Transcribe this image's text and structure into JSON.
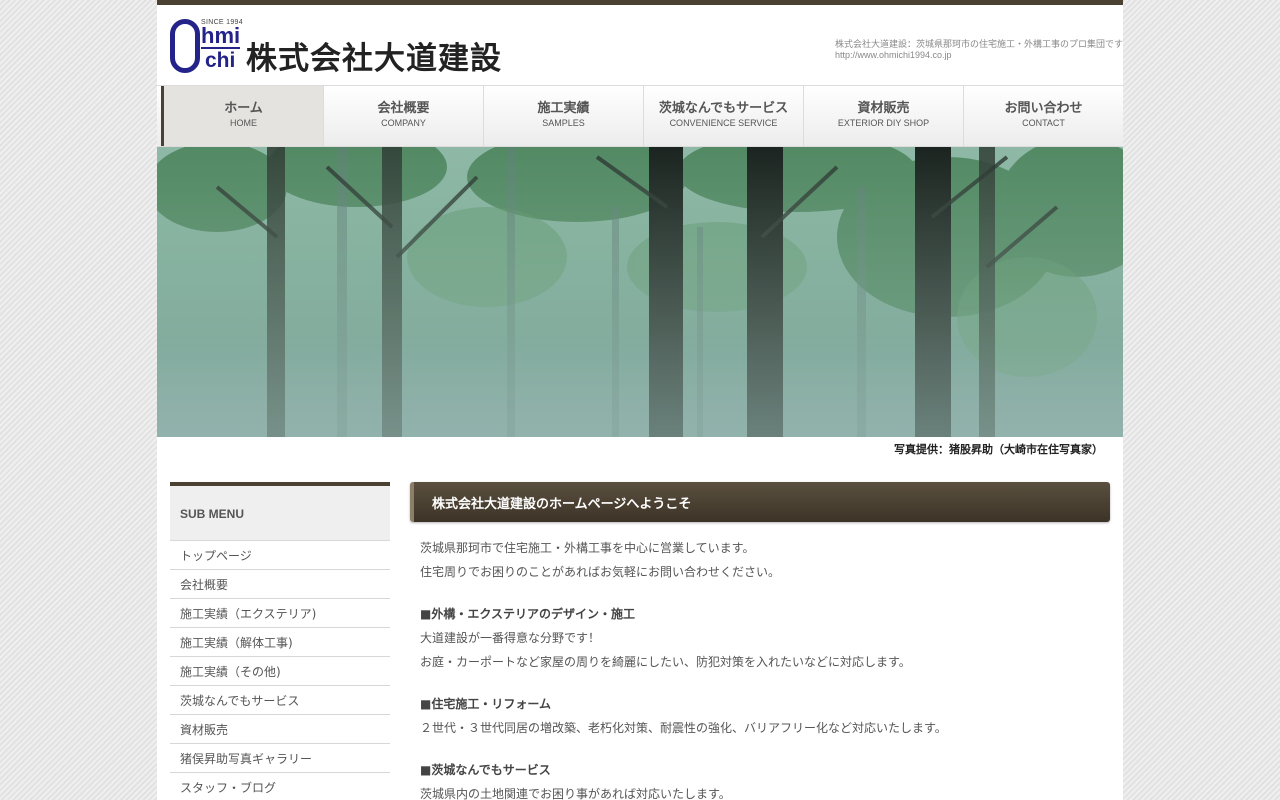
{
  "header": {
    "logo_since": "SINCE 1994",
    "logo_o": "O",
    "logo_hmi": "hmi",
    "logo_chi": "chi",
    "company_name": "株式会社大道建設",
    "tagline_line1": "株式会社大道建設：茨城県那珂市の住宅施工・外構工事のプロ集団です",
    "tagline_line2": "http://www.ohmichi1994.co.jp"
  },
  "nav": {
    "items": [
      {
        "jp": "ホーム",
        "en": "HOME"
      },
      {
        "jp": "会社概要",
        "en": "COMPANY"
      },
      {
        "jp": "施工実績",
        "en": "SAMPLES"
      },
      {
        "jp": "茨城なんでもサービス",
        "en": "CONVENIENCE SERVICE"
      },
      {
        "jp": "資材販売",
        "en": "EXTERIOR DIY SHOP"
      },
      {
        "jp": "お問い合わせ",
        "en": "CONTACT"
      }
    ],
    "active_index": 0
  },
  "hero": {
    "caption": "写真提供：猪股昇助（大崎市在住写真家）"
  },
  "sidebar": {
    "heading": "SUB MENU",
    "items": [
      {
        "label": "トップページ"
      },
      {
        "label": "会社概要"
      },
      {
        "label": "施工実績（エクステリア)"
      },
      {
        "label": "施工実績（解体工事)"
      },
      {
        "label": "施工実績（その他)"
      },
      {
        "label": "茨城なんでもサービス"
      },
      {
        "label": "資材販売"
      },
      {
        "label": "猪俣昇助写真ギャラリー"
      },
      {
        "label": "スタッフ・ブログ"
      }
    ]
  },
  "main": {
    "title": "株式会社大道建設のホームページへようこそ",
    "intro1": "茨城県那珂市で住宅施工・外構工事を中心に営業しています。",
    "intro2": "住宅周りでお困りのことがあればお気軽にお問い合わせください。",
    "sec1_title": "■外構・エクステリアのデザイン・施工",
    "sec1_line1": "大道建設が一番得意な分野です！",
    "sec1_line2": "お庭・カーポートなど家屋の周りを綺麗にしたい、防犯対策を入れたいなどに対応します。",
    "sec2_title": "■住宅施工・リフォーム",
    "sec2_line1": "２世代・３世代同居の増改築、老朽化対策、耐震性の強化、バリアフリー化など対応いたします。",
    "sec3_title": "■茨城なんでもサービス",
    "sec3_line1": "茨城県内の土地関連でお困り事があれば対応いたします。"
  },
  "colors": {
    "accent_dark": "#4a4133",
    "logo_blue": "#23238a"
  }
}
